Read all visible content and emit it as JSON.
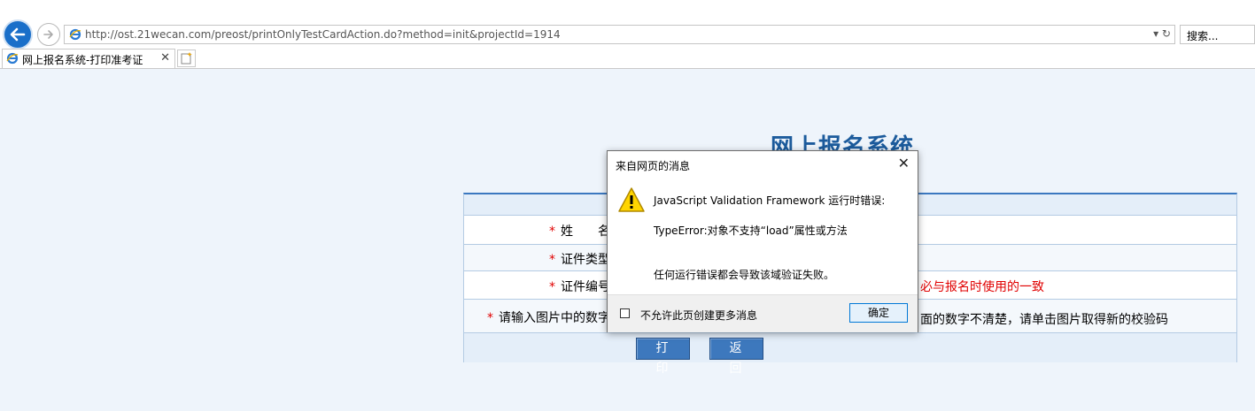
{
  "browser": {
    "url": "http://ost.21wecan.com/preost/printOnlyTestCardAction.do?method=init&projectId=1914",
    "url_controls": "▾ ↻",
    "search_placeholder": "搜索...",
    "tab_title": "网上报名系统-打印准考证",
    "tab_close": "✕"
  },
  "page": {
    "system_title": "网上报名系统",
    "rows": [
      {
        "required": "*",
        "label": "姓　　名"
      },
      {
        "required": "*",
        "label": "证件类型"
      },
      {
        "required": "*",
        "label": "证件编号"
      },
      {
        "required": "*",
        "label": "请输入图片中的数字"
      }
    ],
    "id_note": "必与报名时使用的一致",
    "captcha_note": "面的数字不清楚，请单击图片取得新的校验码",
    "buttons": {
      "print": "打 印",
      "back": "返 回"
    }
  },
  "dialog": {
    "title": "来自网页的消息",
    "close": "✕",
    "message_line1": "JavaScript Validation Framework 运行时错误:",
    "message_line2": "TypeError:对象不支持“load”属性或方法",
    "message_line3": "任何运行错误都会导致该域验证失败。",
    "checkbox_label": "不允许此页创建更多消息",
    "ok_label": "确定",
    "icon": "warning-icon"
  },
  "colors": {
    "accent": "#1a6fc9",
    "title": "#1c5b9c",
    "button": "#3d78bd",
    "required": "#e00000",
    "page_bg": "#eef4fb"
  }
}
